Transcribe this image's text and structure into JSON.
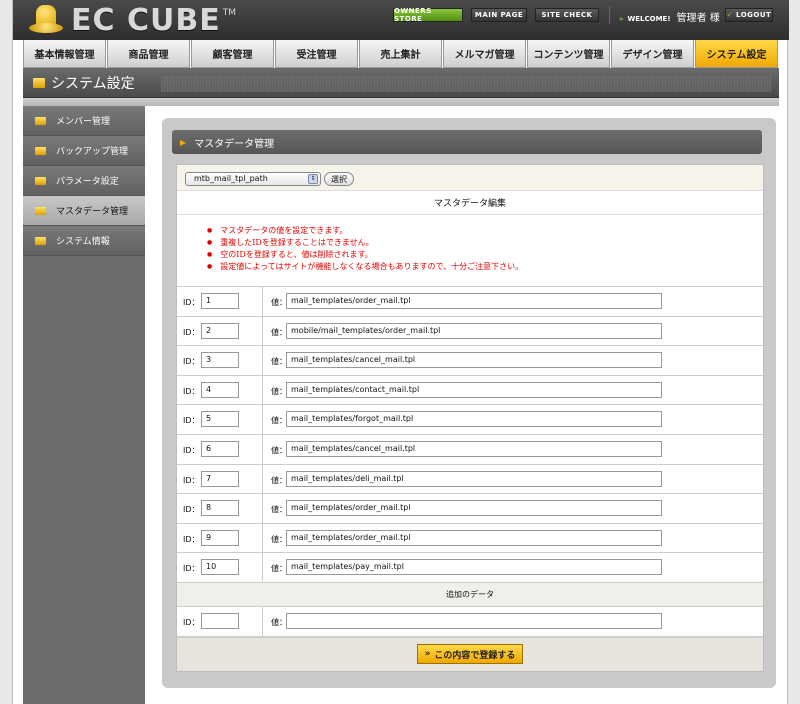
{
  "header": {
    "logo_text": "EC CUBE",
    "logo_tm": "TM",
    "owners_store": "OWNERS STORE",
    "main_page": "MAIN PAGE",
    "site_check": "SITE CHECK",
    "welcome": "WELCOME!",
    "username": "管理者 様",
    "logout": "LOGOUT"
  },
  "nav": {
    "tabs": [
      "基本情報管理",
      "商品管理",
      "顧客管理",
      "受注管理",
      "売上集計",
      "メルマガ管理",
      "コンテンツ管理",
      "デザイン管理",
      "システム設定"
    ],
    "active": "システム設定"
  },
  "page_title": "システム設定",
  "sidebar": {
    "items": [
      "メンバー管理",
      "バックアップ管理",
      "パラメータ設定",
      "マスタデータ管理",
      "システム情報"
    ],
    "active": "マスタデータ管理"
  },
  "panel": {
    "title": "マスタデータ管理",
    "select_value": "mtb_mail_tpl_path",
    "select_button": "選択",
    "section_title": "マスタデータ編集",
    "notes": [
      "マスタデータの値を設定できます。",
      "重複したIDを登録することはできません。",
      "空のIDを登録すると、値は削除されます。",
      "設定値によってはサイトが機能しなくなる場合もありますので、十分ご注意下さい。"
    ],
    "id_label": "ID：",
    "value_label": "値：",
    "rows": [
      {
        "id": "1",
        "value": "mail_templates/order_mail.tpl"
      },
      {
        "id": "2",
        "value": "mobile/mail_templates/order_mail.tpl"
      },
      {
        "id": "3",
        "value": "mail_templates/cancel_mail.tpl"
      },
      {
        "id": "4",
        "value": "mail_templates/contact_mail.tpl"
      },
      {
        "id": "5",
        "value": "mail_templates/forgot_mail.tpl"
      },
      {
        "id": "6",
        "value": "mail_templates/cancel_mail.tpl"
      },
      {
        "id": "7",
        "value": "mail_templates/deli_mail.tpl"
      },
      {
        "id": "8",
        "value": "mail_templates/order_mail.tpl"
      },
      {
        "id": "9",
        "value": "mail_templates/order_mail.tpl"
      },
      {
        "id": "10",
        "value": "mail_templates/pay_mail.tpl"
      }
    ],
    "add_title": "追加のデータ",
    "new_row": {
      "id": "",
      "value": ""
    },
    "register_button": "この内容で登録する"
  },
  "colors": {
    "accent": "#f0a800",
    "owners": "#6aac28",
    "note_red": "#e00000"
  }
}
